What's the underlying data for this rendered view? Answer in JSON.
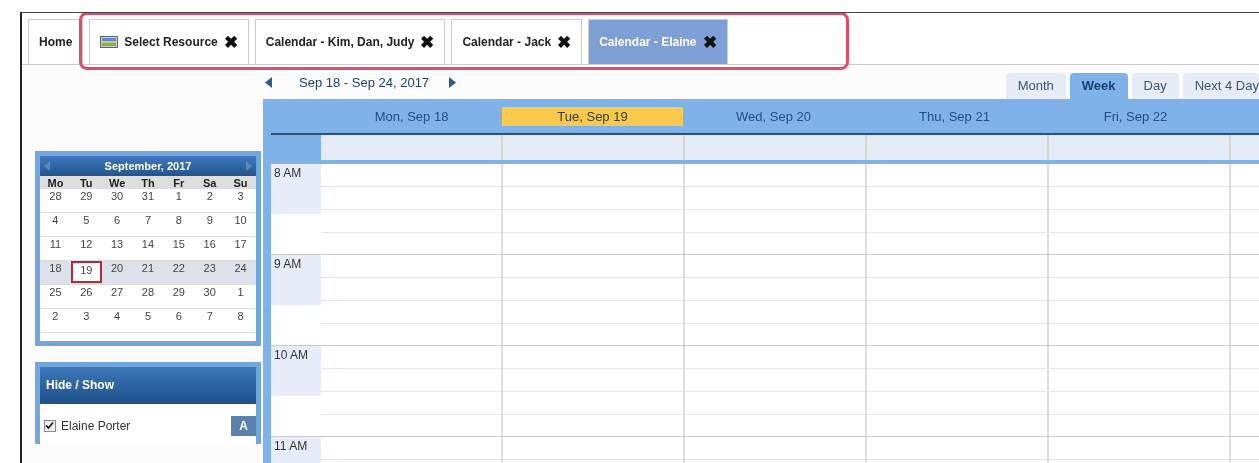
{
  "tabs": [
    {
      "label": "Home",
      "selected": false,
      "closable": false,
      "icon": false
    },
    {
      "label": "Select Resource",
      "selected": false,
      "closable": true,
      "icon": true
    },
    {
      "label": "Calendar - Kim, Dan, Judy",
      "selected": false,
      "closable": true,
      "icon": false
    },
    {
      "label": "Calendar - Jack",
      "selected": false,
      "closable": true,
      "icon": false
    },
    {
      "label": "Calendar - Elaine",
      "selected": true,
      "closable": true,
      "icon": false
    }
  ],
  "close_glyph": "✖",
  "date_range": "Sep 18 - Sep 24, 2017",
  "view_tabs": [
    {
      "label": "Month",
      "selected": false
    },
    {
      "label": "Week",
      "selected": true
    },
    {
      "label": "Day",
      "selected": false
    },
    {
      "label": "Next 4 Day",
      "selected": false
    }
  ],
  "mini_calendar": {
    "title": "September, 2017",
    "weekdays": [
      "Mo",
      "Tu",
      "We",
      "Th",
      "Fr",
      "Sa",
      "Su"
    ],
    "weeks": [
      {
        "selected": false,
        "days": [
          {
            "label": "28",
            "today": false
          },
          {
            "label": "29",
            "today": false
          },
          {
            "label": "30",
            "today": false
          },
          {
            "label": "31",
            "today": false
          },
          {
            "label": "1",
            "today": false
          },
          {
            "label": "2",
            "today": false
          },
          {
            "label": "3",
            "today": false
          }
        ]
      },
      {
        "selected": false,
        "days": [
          {
            "label": "4",
            "today": false
          },
          {
            "label": "5",
            "today": false
          },
          {
            "label": "6",
            "today": false
          },
          {
            "label": "7",
            "today": false
          },
          {
            "label": "8",
            "today": false
          },
          {
            "label": "9",
            "today": false
          },
          {
            "label": "10",
            "today": false
          }
        ]
      },
      {
        "selected": false,
        "days": [
          {
            "label": "11",
            "today": false
          },
          {
            "label": "12",
            "today": false
          },
          {
            "label": "13",
            "today": false
          },
          {
            "label": "14",
            "today": false
          },
          {
            "label": "15",
            "today": false
          },
          {
            "label": "16",
            "today": false
          },
          {
            "label": "17",
            "today": false
          }
        ]
      },
      {
        "selected": true,
        "days": [
          {
            "label": "18",
            "today": false
          },
          {
            "label": "19",
            "today": true
          },
          {
            "label": "20",
            "today": false
          },
          {
            "label": "21",
            "today": false
          },
          {
            "label": "22",
            "today": false
          },
          {
            "label": "23",
            "today": false
          },
          {
            "label": "24",
            "today": false
          }
        ]
      },
      {
        "selected": false,
        "days": [
          {
            "label": "25",
            "today": false
          },
          {
            "label": "26",
            "today": false
          },
          {
            "label": "27",
            "today": false
          },
          {
            "label": "28",
            "today": false
          },
          {
            "label": "29",
            "today": false
          },
          {
            "label": "30",
            "today": false
          },
          {
            "label": "1",
            "today": false
          }
        ]
      },
      {
        "selected": false,
        "days": [
          {
            "label": "2",
            "today": false
          },
          {
            "label": "3",
            "today": false
          },
          {
            "label": "4",
            "today": false
          },
          {
            "label": "5",
            "today": false
          },
          {
            "label": "6",
            "today": false
          },
          {
            "label": "7",
            "today": false
          },
          {
            "label": "8",
            "today": false
          }
        ]
      }
    ]
  },
  "hide_show": {
    "title": "Hide / Show",
    "resources": [
      {
        "name": "Elaine Porter",
        "checked": true,
        "badge": "A"
      }
    ]
  },
  "days": [
    {
      "label": "Mon, Sep 18",
      "selected": false
    },
    {
      "label": "Tue, Sep 19",
      "selected": true
    },
    {
      "label": "Wed, Sep 20",
      "selected": false
    },
    {
      "label": "Thu, Sep 21",
      "selected": false
    },
    {
      "label": "Fri, Sep 22",
      "selected": false
    }
  ],
  "hours": [
    "8 AM",
    "9 AM",
    "10 AM",
    "11 AM"
  ]
}
